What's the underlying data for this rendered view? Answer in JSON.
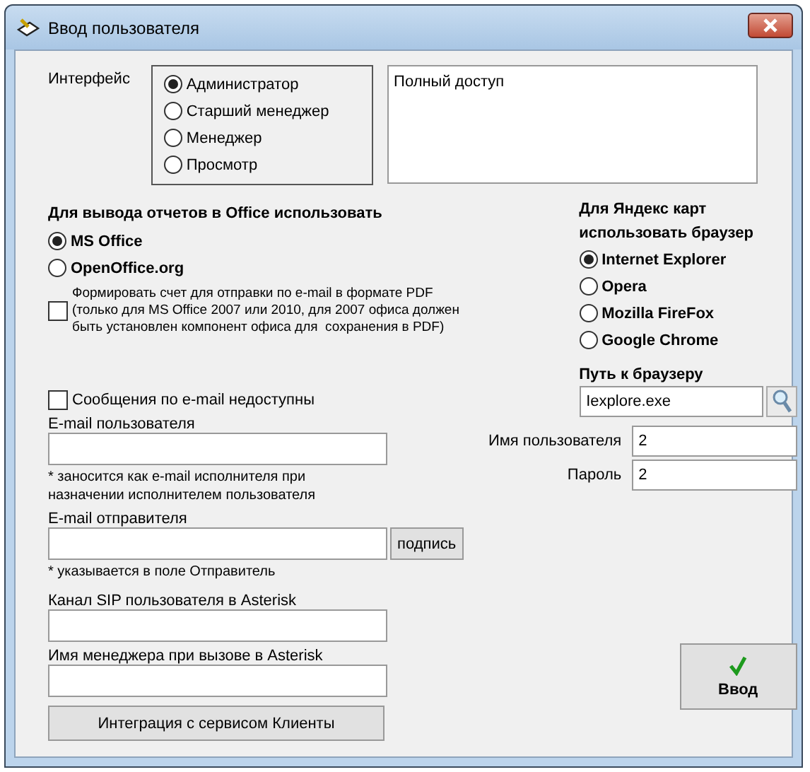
{
  "window": {
    "title": "Ввод пользователя"
  },
  "interface": {
    "label": "Интерфейс",
    "options": [
      {
        "label": "Администратор",
        "selected": true
      },
      {
        "label": "Старший менеджер",
        "selected": false
      },
      {
        "label": "Менеджер",
        "selected": false
      },
      {
        "label": "Просмотр",
        "selected": false
      }
    ],
    "description": "Полный доступ"
  },
  "office": {
    "heading": "Для вывода отчетов в Office использовать",
    "options": [
      {
        "label": "MS Office",
        "selected": true
      },
      {
        "label": "OpenOffice.org",
        "selected": false
      }
    ],
    "pdf_checkbox": {
      "label": "Формировать счет для отправки по e-mail в формате PDF\n(только для MS Office 2007 или 2010, для 2007 офиса должен\nбыть установлен компонент офиса для  сохранения в PDF)",
      "checked": false
    }
  },
  "browser": {
    "heading": "Для Яндекс карт\nиспользовать браузер",
    "options": [
      {
        "label": "Internet Explorer",
        "selected": true
      },
      {
        "label": "Opera",
        "selected": false
      },
      {
        "label": "Mozilla FireFox",
        "selected": false
      },
      {
        "label": "Google Chrome",
        "selected": false
      }
    ],
    "path_label": "Путь к браузеру",
    "path_value": "Iexplore.exe"
  },
  "email_disabled": {
    "label": "Сообщения по e-mail недоступны",
    "checked": false
  },
  "user_email": {
    "label": "E-mail пользователя",
    "note": "* заносится как e-mail исполнителя при\nназначении исполнителем пользователя"
  },
  "sender_email": {
    "label": "E-mail отправителя",
    "note": "* указывается в поле Отправитель",
    "signature_button": "подпись"
  },
  "sip": {
    "label": "Канал SIP пользователя в Asterisk"
  },
  "manager_name": {
    "label": "Имя менеджера при вызове в Asterisk"
  },
  "integration_button": "Интеграция с сервисом Клиенты",
  "username": {
    "label": "Имя пользователя",
    "value": "2"
  },
  "password": {
    "label": "Пароль",
    "value": "2"
  },
  "submit_button": "Ввод"
}
